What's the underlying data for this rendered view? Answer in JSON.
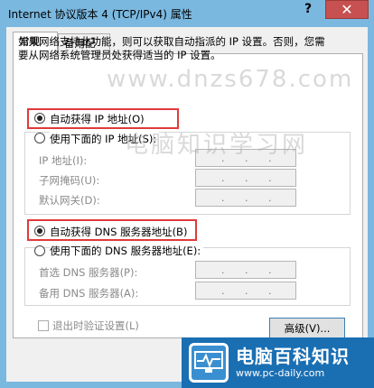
{
  "window": {
    "title": "Internet 协议版本 4 (TCP/IPv4) 属性",
    "help_symbol": "?",
    "close_symbol": "✕"
  },
  "tabs": [
    {
      "label": "常规",
      "active": true
    },
    {
      "label": "备用配置",
      "active": false
    }
  ],
  "description": "如果网络支持此功能，则可以获取自动指派的 IP 设置。否则，您需要从网络系统管理员处获得适当的 IP 设置。",
  "ip_section": {
    "auto_label": "自动获得 IP 地址(O)",
    "manual_label": "使用下面的 IP 地址(S):",
    "auto_selected": true,
    "fields": [
      {
        "label": "IP 地址(I):"
      },
      {
        "label": "子网掩码(U):"
      },
      {
        "label": "默认网关(D):"
      }
    ]
  },
  "dns_section": {
    "auto_label": "自动获得 DNS 服务器地址(B)",
    "manual_label": "使用下面的 DNS 服务器地址(E):",
    "auto_selected": true,
    "fields": [
      {
        "label": "首选 DNS 服务器(P):"
      },
      {
        "label": "备用 DNS 服务器(A):"
      }
    ]
  },
  "validate_label": "退出时验证设置(L)",
  "advanced_button": "高级(V)...",
  "watermarks": {
    "site": "www.dnzs678.com",
    "brand": "电脑知识学习网"
  },
  "logo": {
    "brand": "电脑百科知识",
    "url": "www.pc-daily.com"
  },
  "colors": {
    "highlight": "#e03a3a",
    "titlebar": "#7ab8e0",
    "close": "#c75050",
    "logo_bg": "#1a6fb3"
  }
}
